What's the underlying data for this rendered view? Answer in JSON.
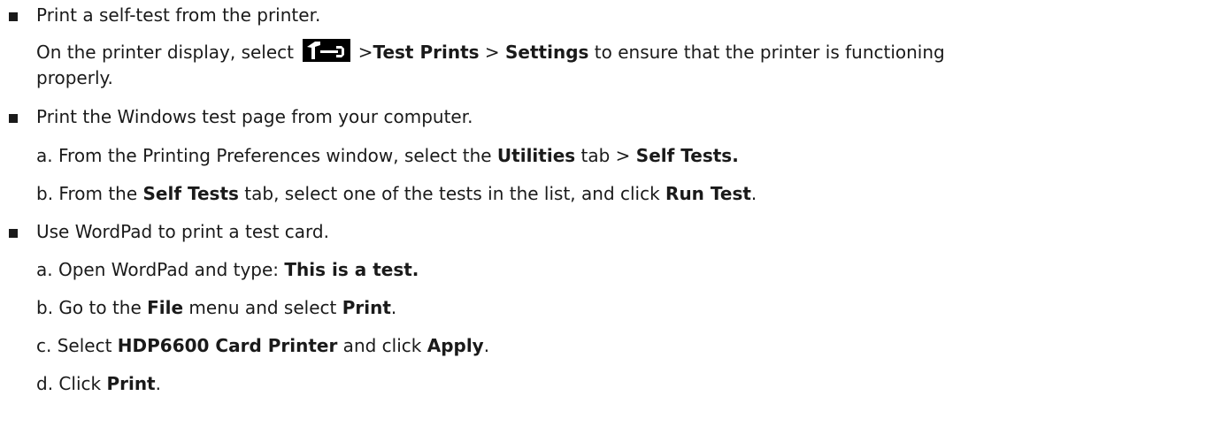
{
  "bullets": [
    {
      "text": "Print a self-test from the printer.",
      "body": {
        "prefix": "On the printer display, select ",
        "icon": "tools-icon",
        "sep1": " >",
        "item1": "Test Prints",
        "sep2": " > ",
        "item2": "Settings",
        "suffix": " to ensure that the printer is functioning",
        "continuation": "properly."
      }
    },
    {
      "text": "Print the Windows test page from your computer.",
      "steps": [
        {
          "letter": "a.",
          "pre": "From the Printing Preferences window, select the ",
          "b1": "Utilities",
          "mid": " tab > ",
          "b2": "Self Tests."
        },
        {
          "letter": "b.",
          "pre": "From the ",
          "b1": "Self Tests",
          "mid": " tab, select one of the tests in the list, and click ",
          "b2": "Run Test",
          "post": "."
        }
      ]
    },
    {
      "text": "Use WordPad to print a test card.",
      "steps": [
        {
          "letter": "a.",
          "pre": "Open WordPad and type: ",
          "b1": "This is a test."
        },
        {
          "letter": "b.",
          "pre": "Go to the ",
          "b1": "File",
          "mid": " menu and select ",
          "b2": "Print",
          "post": "."
        },
        {
          "letter": "c.",
          "pre": "Select ",
          "b1": "HDP6600 Card Printer",
          "mid": " and click ",
          "b2": "Apply",
          "post": "."
        },
        {
          "letter": "d.",
          "pre": "Click ",
          "b1": "Print",
          "post": "."
        }
      ]
    }
  ]
}
